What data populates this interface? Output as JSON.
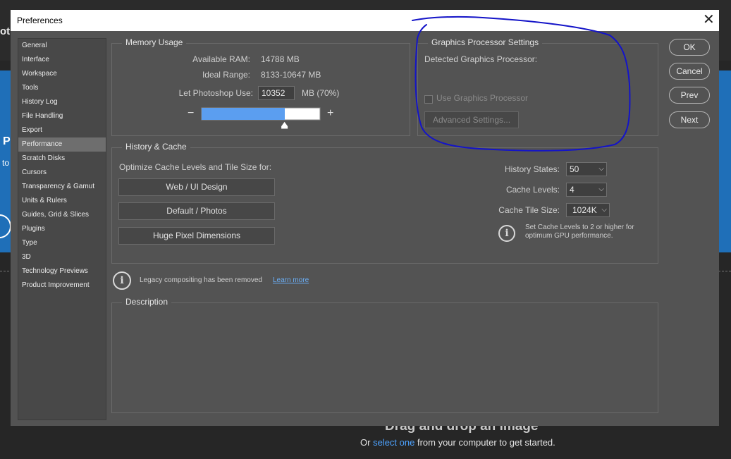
{
  "background": {
    "title_fragment": "ot",
    "left_panel_letter": "P",
    "left_panel_text": "to",
    "drag_text": "Drag and drop an image",
    "or_prefix": "Or",
    "select_link": "select one",
    "or_suffix": "from your computer to get started."
  },
  "dialog": {
    "title": "Preferences",
    "close_glyph": "✕"
  },
  "sidebar": {
    "items": [
      {
        "label": "General"
      },
      {
        "label": "Interface"
      },
      {
        "label": "Workspace"
      },
      {
        "label": "Tools"
      },
      {
        "label": "History Log"
      },
      {
        "label": "File Handling"
      },
      {
        "label": "Export"
      },
      {
        "label": "Performance"
      },
      {
        "label": "Scratch Disks"
      },
      {
        "label": "Cursors"
      },
      {
        "label": "Transparency & Gamut"
      },
      {
        "label": "Units & Rulers"
      },
      {
        "label": "Guides, Grid & Slices"
      },
      {
        "label": "Plugins"
      },
      {
        "label": "Type"
      },
      {
        "label": "3D"
      },
      {
        "label": "Technology Previews"
      },
      {
        "label": "Product Improvement"
      }
    ],
    "selected": "Performance"
  },
  "memory": {
    "title": "Memory Usage",
    "available_label": "Available RAM:",
    "available_value": "14788 MB",
    "ideal_label": "Ideal Range:",
    "ideal_value": "8133-10647 MB",
    "let_label": "Let Photoshop Use:",
    "let_value": "10352",
    "let_unit": "MB (70%)",
    "minus": "−",
    "plus": "+",
    "slider_fraction": 0.7,
    "slider_color": "#5b9ef0"
  },
  "gpu": {
    "title": "Graphics Processor Settings",
    "detected_label": "Detected Graphics Processor:",
    "use_label": "Use Graphics Processor",
    "advanced_button": "Advanced Settings..."
  },
  "buttons": {
    "ok": "OK",
    "cancel": "Cancel",
    "prev": "Prev",
    "next": "Next"
  },
  "history": {
    "title": "History & Cache",
    "optimize_label": "Optimize Cache Levels and Tile Size for:",
    "web_button": "Web / UI Design",
    "default_button": "Default / Photos",
    "huge_button": "Huge Pixel Dimensions",
    "states_label": "History States:",
    "states_value": "50",
    "levels_label": "Cache Levels:",
    "levels_value": "4",
    "tile_label": "Cache Tile Size:",
    "tile_value": "1024K",
    "hint_line1": "Set Cache Levels to 2 or higher for",
    "hint_line2": "optimum GPU performance."
  },
  "legacy": {
    "text": "Legacy compositing has been removed",
    "link": "Learn more"
  },
  "description": {
    "title": "Description"
  },
  "annotation": {
    "stroke_color": "#1414c8"
  }
}
